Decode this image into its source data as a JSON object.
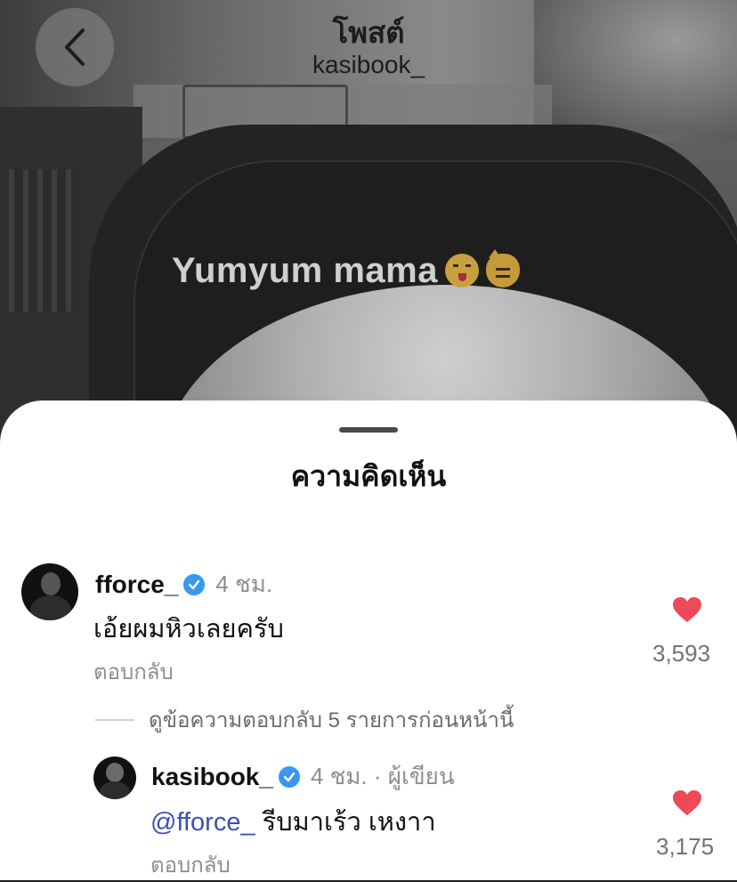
{
  "header": {
    "title": "โพสต์",
    "subtitle": "kasibook_"
  },
  "post": {
    "overlay_text": "Yumyum mama"
  },
  "sheet": {
    "title": "ความคิดเห็น"
  },
  "comments": [
    {
      "username": "fforce_",
      "verified": true,
      "time": "4 ชม.",
      "text": "เอ้ยผมหิวเลยครับ",
      "reply_label": "ตอบกลับ",
      "likes": "3,593"
    }
  ],
  "view_replies": "ดูข้อความตอบกลับ 5 รายการก่อนหน้านี้",
  "replies": [
    {
      "username": "kasibook_",
      "verified": true,
      "time": "4 ชม. · ผู้เขียน",
      "mention": "@fforce_",
      "text": " รีบมาเร้ว เหงาา",
      "reply_label": "ตอบกลับ",
      "likes": "3,175"
    }
  ],
  "colors": {
    "heart": "#ed4956",
    "verified": "#3897f0",
    "mention": "#3d4fb5"
  }
}
